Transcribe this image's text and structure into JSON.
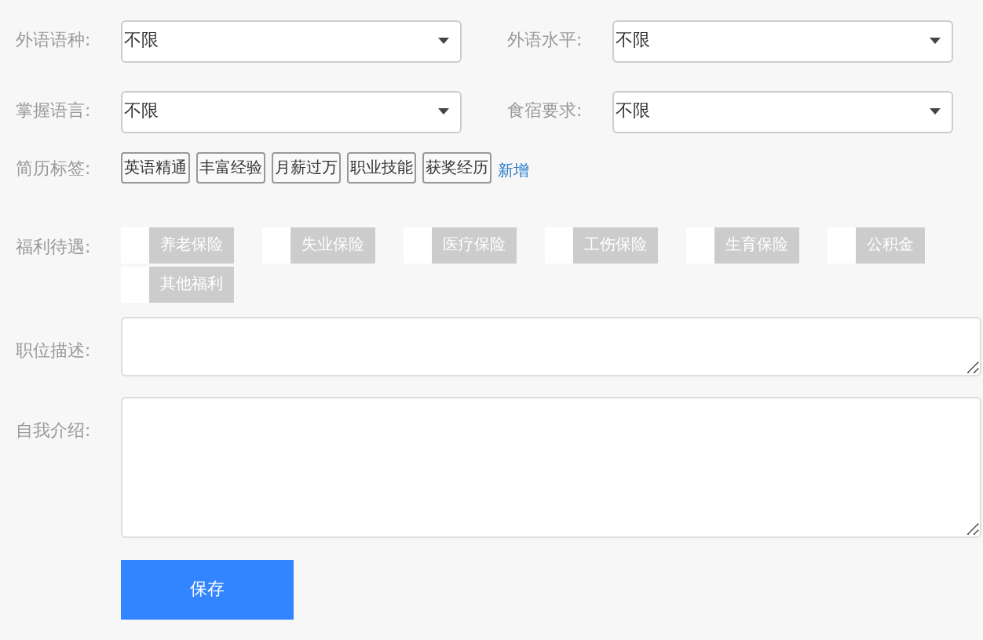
{
  "selects": [
    {
      "label": "外语语种:",
      "value": "不限"
    },
    {
      "label": "外语水平:",
      "value": "不限"
    },
    {
      "label": "掌握语言:",
      "value": "不限"
    },
    {
      "label": "食宿要求:",
      "value": "不限"
    }
  ],
  "tags": {
    "label": "简历标签:",
    "items": [
      "英语精通",
      "丰富经验",
      "月薪过万",
      "职业技能",
      "获奖经历"
    ],
    "add": "新增"
  },
  "benefits": {
    "label": "福利待遇:",
    "items": [
      {
        "text": "养老保险",
        "checked": false
      },
      {
        "text": "失业保险",
        "checked": false
      },
      {
        "text": "医疗保险",
        "checked": false
      },
      {
        "text": "工伤保险",
        "checked": false
      },
      {
        "text": "生育保险",
        "checked": false
      },
      {
        "text": "公积金",
        "checked": false
      },
      {
        "text": "其他福利",
        "checked": false
      }
    ]
  },
  "textareas": [
    {
      "label": "职位描述:",
      "kind": "short"
    },
    {
      "label": "自我介绍:",
      "kind": "tall"
    }
  ],
  "save": "保存"
}
